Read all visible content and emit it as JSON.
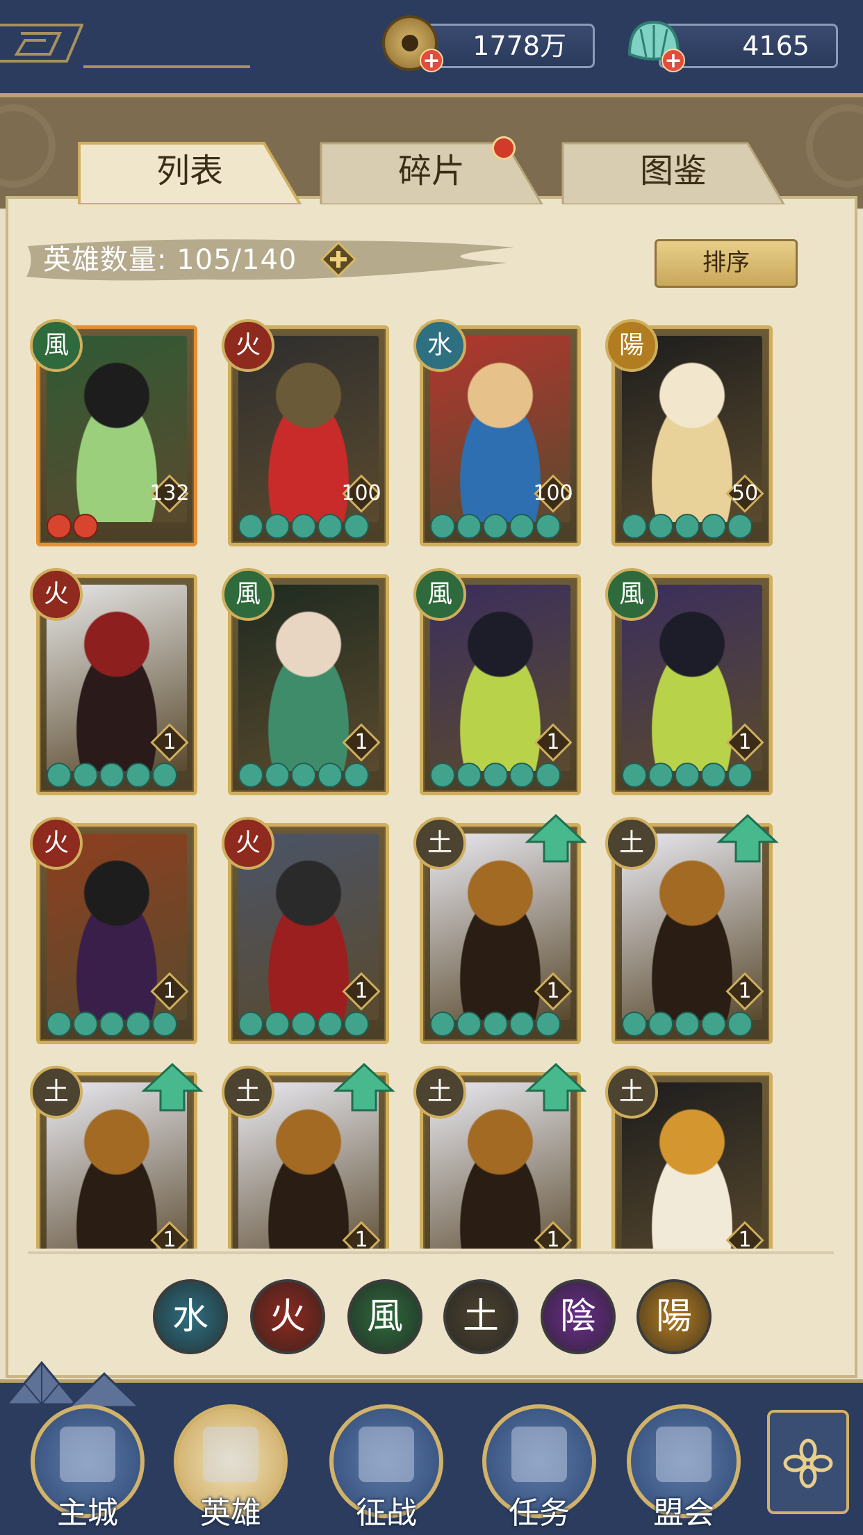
{
  "resources": {
    "coins": "1778万",
    "jade": "4165",
    "add_symbol": "+"
  },
  "tabs": [
    {
      "label": "列表",
      "active": true
    },
    {
      "label": "碎片",
      "active": false,
      "has_notification": true
    },
    {
      "label": "图鉴",
      "active": false
    }
  ],
  "hero_count": {
    "text": "英雄数量: 105/140",
    "add_symbol": "+"
  },
  "sort_label": "排序",
  "colors": {
    "water": "#2e6f80",
    "fire": "#8e2a1e",
    "wind": "#2e6a3c",
    "earth": "#4c4330",
    "yin": "#6a2e8a",
    "yang": "#b27c20"
  },
  "heroes": [
    {
      "element": "wind",
      "element_glyph": "風",
      "level": "132",
      "stars": 2,
      "star_color": "red",
      "upgrade": false,
      "portrait": [
        "#2f5a35",
        "#9ccf7c",
        "#1d1d1d"
      ]
    },
    {
      "element": "fire",
      "element_glyph": "火",
      "level": "100",
      "stars": 5,
      "star_color": "green",
      "upgrade": false,
      "portrait": [
        "#2e2e2e",
        "#c92a2a",
        "#6b5a37"
      ]
    },
    {
      "element": "water",
      "element_glyph": "水",
      "level": "100",
      "stars": 5,
      "star_color": "green",
      "upgrade": false,
      "portrait": [
        "#b2362e",
        "#2e6fb2",
        "#e6c28a"
      ]
    },
    {
      "element": "yang",
      "element_glyph": "陽",
      "level": "50",
      "stars": 5,
      "star_color": "green",
      "upgrade": false,
      "portrait": [
        "#1d1d1d",
        "#e8d29a",
        "#f2e7cc"
      ]
    },
    {
      "element": "fire",
      "element_glyph": "火",
      "level": "1",
      "stars": 5,
      "star_color": "green",
      "upgrade": false,
      "portrait": [
        "#e6e6e6",
        "#2a1a1a",
        "#8e1f1f"
      ]
    },
    {
      "element": "wind",
      "element_glyph": "風",
      "level": "1",
      "stars": 5,
      "star_color": "green",
      "upgrade": false,
      "portrait": [
        "#1d2a20",
        "#3f8c6a",
        "#e9d6c2"
      ]
    },
    {
      "element": "wind",
      "element_glyph": "風",
      "level": "1",
      "stars": 5,
      "star_color": "green",
      "upgrade": false,
      "portrait": [
        "#3a2e5e",
        "#b8d24a",
        "#1d1d2a"
      ]
    },
    {
      "element": "wind",
      "element_glyph": "風",
      "level": "1",
      "stars": 5,
      "star_color": "green",
      "upgrade": false,
      "portrait": [
        "#3a2e5e",
        "#b8d24a",
        "#1d1d2a"
      ]
    },
    {
      "element": "fire",
      "element_glyph": "火",
      "level": "1",
      "stars": 5,
      "star_color": "green",
      "upgrade": false,
      "portrait": [
        "#8e3f1f",
        "#3a1f4a",
        "#1d1d1d"
      ]
    },
    {
      "element": "fire",
      "element_glyph": "火",
      "level": "1",
      "stars": 5,
      "star_color": "green",
      "upgrade": false,
      "portrait": [
        "#4a5468",
        "#9c1f1f",
        "#2a2a2a"
      ]
    },
    {
      "element": "earth",
      "element_glyph": "土",
      "level": "1",
      "stars": 5,
      "star_color": "green",
      "upgrade": true,
      "portrait": [
        "#e8e8f0",
        "#2a1d14",
        "#a36a24"
      ]
    },
    {
      "element": "earth",
      "element_glyph": "土",
      "level": "1",
      "stars": 5,
      "star_color": "green",
      "upgrade": true,
      "portrait": [
        "#e8e8f0",
        "#2a1d14",
        "#a36a24"
      ]
    },
    {
      "element": "earth",
      "element_glyph": "土",
      "level": "1",
      "stars": 0,
      "star_color": "green",
      "upgrade": true,
      "portrait": [
        "#e8e8f0",
        "#2a1d14",
        "#a36a24"
      ]
    },
    {
      "element": "earth",
      "element_glyph": "土",
      "level": "1",
      "stars": 0,
      "star_color": "green",
      "upgrade": true,
      "portrait": [
        "#e8e8f0",
        "#2a1d14",
        "#a36a24"
      ]
    },
    {
      "element": "earth",
      "element_glyph": "土",
      "level": "1",
      "stars": 0,
      "star_color": "green",
      "upgrade": true,
      "portrait": [
        "#e8e8f0",
        "#2a1d14",
        "#a36a24"
      ]
    },
    {
      "element": "earth",
      "element_glyph": "土",
      "level": "1",
      "stars": 0,
      "star_color": "green",
      "upgrade": false,
      "portrait": [
        "#1d1d1d",
        "#f2ead8",
        "#d4962e"
      ]
    }
  ],
  "element_filters": [
    {
      "key": "water",
      "glyph": "水"
    },
    {
      "key": "fire",
      "glyph": "火"
    },
    {
      "key": "wind",
      "glyph": "風"
    },
    {
      "key": "earth",
      "glyph": "土"
    },
    {
      "key": "yin",
      "glyph": "陰"
    },
    {
      "key": "yang",
      "glyph": "陽"
    }
  ],
  "nav": [
    {
      "key": "city",
      "label": "主城",
      "icon": "pagoda-icon"
    },
    {
      "key": "heroes",
      "label": "英雄",
      "icon": "hero-portrait-icon",
      "active": true
    },
    {
      "key": "campaign",
      "label": "征战",
      "icon": "war-drum-icon"
    },
    {
      "key": "tasks",
      "label": "任务",
      "icon": "scroll-icon"
    },
    {
      "key": "alliance",
      "label": "盟会",
      "icon": "gate-icon"
    }
  ],
  "menu_icon": "flower-menu-icon"
}
